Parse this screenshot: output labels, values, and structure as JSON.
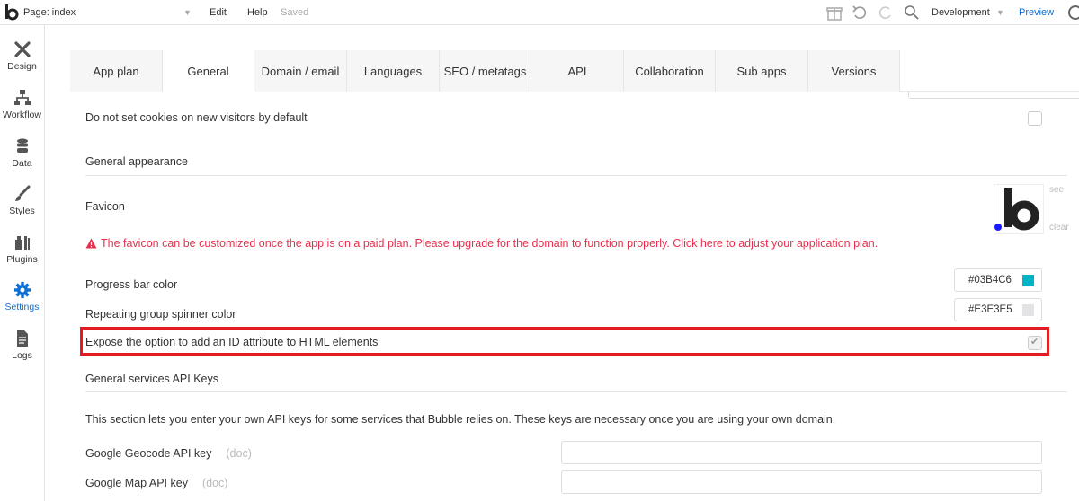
{
  "topbar": {
    "page_label": "Page: index",
    "edit": "Edit",
    "help": "Help",
    "saved": "Saved",
    "environment": "Development",
    "preview": "Preview"
  },
  "sidebar": {
    "items": [
      {
        "label": "Design",
        "icon": "design-icon"
      },
      {
        "label": "Workflow",
        "icon": "workflow-icon"
      },
      {
        "label": "Data",
        "icon": "data-icon"
      },
      {
        "label": "Styles",
        "icon": "styles-icon"
      },
      {
        "label": "Plugins",
        "icon": "plugins-icon"
      },
      {
        "label": "Settings",
        "icon": "settings-icon",
        "active": true
      },
      {
        "label": "Logs",
        "icon": "logs-icon"
      }
    ]
  },
  "tabs": [
    {
      "label": "App plan"
    },
    {
      "label": "General",
      "active": true
    },
    {
      "label": "Domain / email"
    },
    {
      "label": "Languages"
    },
    {
      "label": "SEO / metatags"
    },
    {
      "label": "API"
    },
    {
      "label": "Collaboration"
    },
    {
      "label": "Sub apps"
    },
    {
      "label": "Versions"
    }
  ],
  "settings": {
    "cookies_label": "Do not set cookies on new visitors by default",
    "general_appearance": "General appearance",
    "favicon_label": "Favicon",
    "favicon_see": "see",
    "favicon_clear": "clear",
    "favicon_warning": "The favicon can be customized once the app is on a paid plan. Please upgrade for the domain to function properly. Click here to adjust your application plan.",
    "progress_bar_label": "Progress bar color",
    "progress_bar_color": "#03B4C6",
    "spinner_label": "Repeating group spinner color",
    "spinner_color": "#E3E3E5",
    "expose_id_label": "Expose the option to add an ID attribute to HTML elements",
    "expose_id_checked": true,
    "api_keys_header": "General services API Keys",
    "api_keys_description": "This section lets you enter your own API keys for some services that Bubble relies on. These keys are necessary once you are using your own domain.",
    "geocode_label": "Google Geocode API key",
    "geocode_doc": "(doc)",
    "map_label": "Google Map API key",
    "map_doc": "(doc)"
  },
  "colors": {
    "accent": "#0b6fd8",
    "warning": "#e5304d",
    "highlight": "#e31b23"
  }
}
